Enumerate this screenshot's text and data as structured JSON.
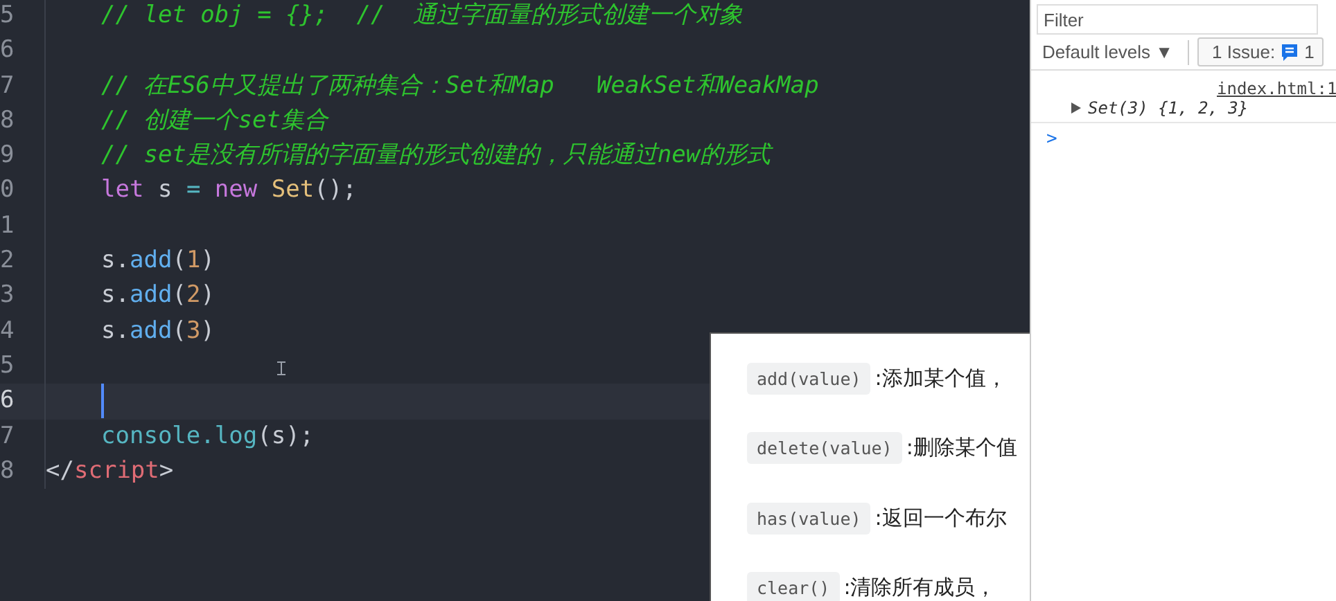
{
  "editor": {
    "lines": [
      {
        "number": "5",
        "indented": true,
        "active": false,
        "tokens": [
          {
            "kind": "comment",
            "text": "// let obj = {};  //  通过字面量的形式创建一个对象"
          }
        ]
      },
      {
        "number": "6",
        "indented": true,
        "active": false
      },
      {
        "number": "7",
        "indented": true,
        "active": false,
        "tokens": [
          {
            "kind": "comment",
            "text": "// 在ES6中又提出了两种集合：Set和Map   WeakSet和WeakMap"
          }
        ]
      },
      {
        "number": "8",
        "indented": true,
        "active": false,
        "tokens": [
          {
            "kind": "comment",
            "text": "// 创建一个set集合"
          }
        ]
      },
      {
        "number": "9",
        "indented": true,
        "active": false,
        "tokens": [
          {
            "kind": "comment",
            "text": "// set是没有所谓的字面量的形式创建的，只能通过new的形式"
          }
        ]
      },
      {
        "number": "0",
        "indented": true,
        "active": false,
        "tokens": [
          {
            "kind": "keyword",
            "text": "let"
          },
          {
            "kind": "plain",
            "text": " s "
          },
          {
            "kind": "operator",
            "text": "="
          },
          {
            "kind": "keyword",
            "text": " new"
          },
          {
            "kind": "class",
            "text": " Set"
          },
          {
            "kind": "plain",
            "text": "();"
          }
        ]
      },
      {
        "number": "1",
        "indented": true,
        "active": false
      },
      {
        "number": "2",
        "indented": true,
        "active": false,
        "tokens": [
          {
            "kind": "plain",
            "text": "s."
          },
          {
            "kind": "func",
            "text": "add"
          },
          {
            "kind": "plain",
            "text": "("
          },
          {
            "kind": "number",
            "text": "1"
          },
          {
            "kind": "plain",
            "text": ")"
          }
        ]
      },
      {
        "number": "3",
        "indented": true,
        "active": false,
        "tokens": [
          {
            "kind": "plain",
            "text": "s."
          },
          {
            "kind": "func",
            "text": "add"
          },
          {
            "kind": "plain",
            "text": "("
          },
          {
            "kind": "number",
            "text": "2"
          },
          {
            "kind": "plain",
            "text": ")"
          }
        ]
      },
      {
        "number": "4",
        "indented": true,
        "active": false,
        "tokens": [
          {
            "kind": "plain",
            "text": "s."
          },
          {
            "kind": "func",
            "text": "add"
          },
          {
            "kind": "plain",
            "text": "("
          },
          {
            "kind": "number",
            "text": "3"
          },
          {
            "kind": "plain",
            "text": ")"
          }
        ]
      },
      {
        "number": "5",
        "indented": true,
        "active": false
      },
      {
        "number": "6",
        "indented": true,
        "active": true
      },
      {
        "number": "7",
        "indented": true,
        "active": false,
        "tokens": [
          {
            "kind": "builtin",
            "text": "console.log"
          },
          {
            "kind": "plain",
            "text": "(s);"
          }
        ]
      },
      {
        "number": "8",
        "indented": false,
        "active": false,
        "tokens": [
          {
            "kind": "plain",
            "text": "</"
          },
          {
            "kind": "tag",
            "text": "script"
          },
          {
            "kind": "plain",
            "text": ">"
          }
        ]
      }
    ]
  },
  "tooltip": {
    "items": [
      {
        "code": "add(value)",
        "text": ":添加某个值，"
      },
      {
        "code": "delete(value)",
        "text": ":删除某个值"
      },
      {
        "code": "has(value)",
        "text": ":返回一个布尔"
      },
      {
        "code": "clear()",
        "text": ":清除所有成员，"
      }
    ]
  },
  "console": {
    "filter": {
      "placeholder": "Filter"
    },
    "levels": "Default levels ▼",
    "issues": {
      "label": "1 Issue:",
      "count": "1"
    },
    "messages": [
      {
        "source": "index.html:1",
        "text": "Set(3) {1, 2, 3}",
        "expanded": false
      }
    ],
    "prompt": ">"
  }
}
